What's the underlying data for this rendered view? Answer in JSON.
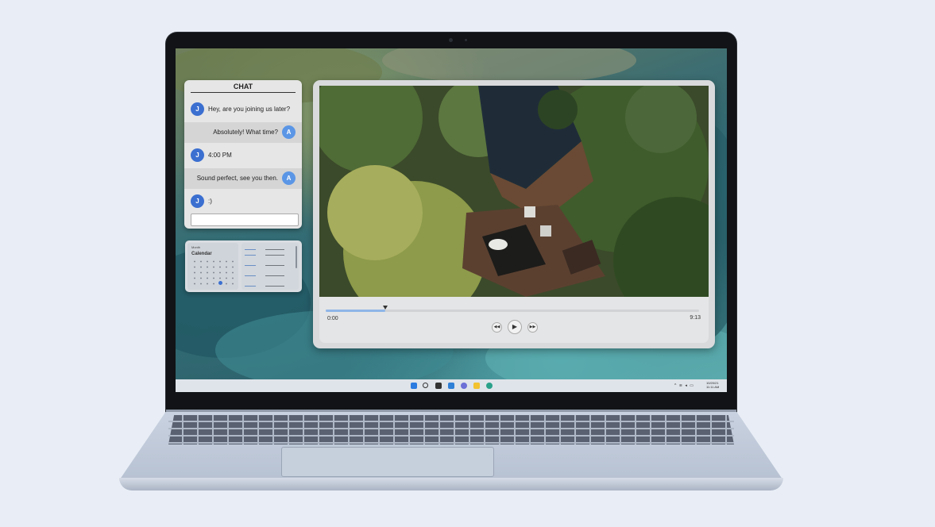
{
  "chat": {
    "title": "CHAT",
    "messages": [
      {
        "sender": "J",
        "text": "Hey, are you joining us later?"
      },
      {
        "sender": "A",
        "text": "Absolutely! What time?"
      },
      {
        "sender": "J",
        "text": "4:00 PM"
      },
      {
        "sender": "A",
        "text": "Sound perfect, see you then."
      },
      {
        "sender": "J",
        "text": ":)"
      }
    ],
    "input_value": ""
  },
  "calendar": {
    "month": "Month",
    "title": "Calendar"
  },
  "player": {
    "current_time": "0:00",
    "duration": "9:13",
    "progress": 0.16,
    "prev_icon": "skip-back-icon",
    "play_icon": "play-icon",
    "next_icon": "skip-forward-icon"
  },
  "taskbar": {
    "icons": [
      "windows-start-icon",
      "search-icon",
      "task-view-icon",
      "widgets-icon",
      "chat-icon",
      "file-explorer-icon",
      "edge-browser-icon"
    ],
    "tray_glyphs": "^ ≋ ◂ ▭",
    "date": "10/20/21",
    "time": "11:11 AM"
  },
  "colors": {
    "avatar_j": "#3b6fd0",
    "avatar_a": "#5b96e6",
    "progress_fill": "#8fb6e8"
  }
}
